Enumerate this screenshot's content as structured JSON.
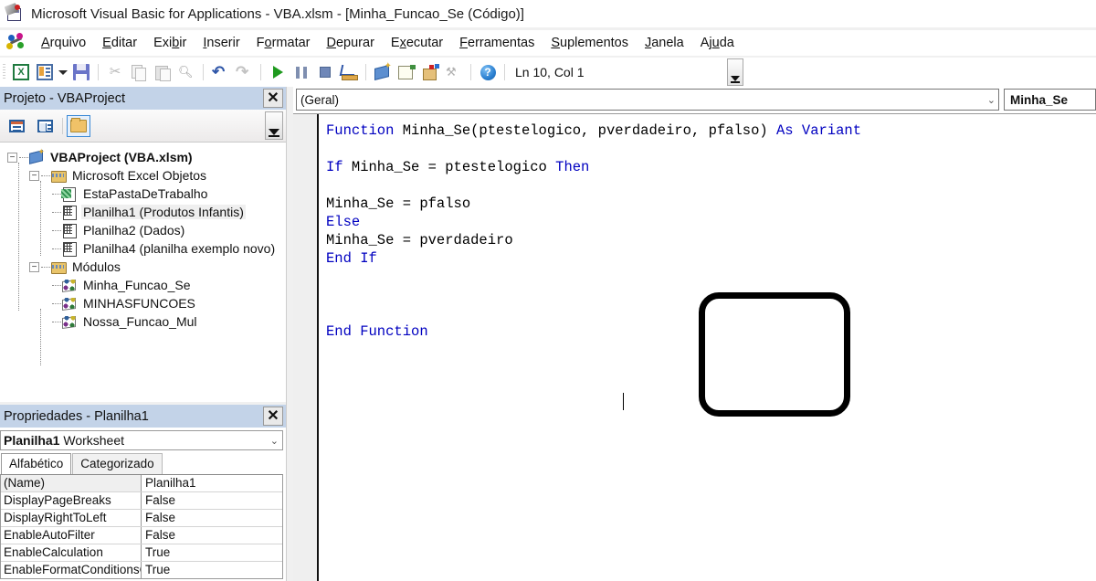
{
  "window": {
    "title": "Microsoft Visual Basic for Applications - VBA.xlsm - [Minha_Funcao_Se (Código)]",
    "app_icon": "vba-app-icon"
  },
  "menubar": {
    "logo_icon": "vba-logo-icon",
    "items": [
      {
        "label": "Arquivo",
        "accel": "A"
      },
      {
        "label": "Editar",
        "accel": "E"
      },
      {
        "label": "Exibir",
        "accel": "b"
      },
      {
        "label": "Inserir",
        "accel": "I"
      },
      {
        "label": "Formatar",
        "accel": "o"
      },
      {
        "label": "Depurar",
        "accel": "D"
      },
      {
        "label": "Executar",
        "accel": "x"
      },
      {
        "label": "Ferramentas",
        "accel": "F"
      },
      {
        "label": "Suplementos",
        "accel": "S"
      },
      {
        "label": "Janela",
        "accel": "J"
      },
      {
        "label": "Ajuda",
        "accel": "u"
      }
    ]
  },
  "toolbar": {
    "buttons": [
      {
        "name": "view-excel-icon",
        "title": "Exibir Microsoft Excel",
        "enabled": true
      },
      {
        "name": "insert-userform-icon",
        "title": "Inserir UserForm",
        "enabled": true
      },
      {
        "name": "insert-dropdown-caret-icon",
        "title": "Inserir",
        "enabled": true
      },
      {
        "name": "save-icon",
        "title": "Salvar VBA.xlsm",
        "enabled": true
      },
      {
        "name": "cut-icon",
        "title": "Recortar",
        "enabled": false
      },
      {
        "name": "copy-icon",
        "title": "Copiar",
        "enabled": false
      },
      {
        "name": "paste-icon",
        "title": "Colar",
        "enabled": false
      },
      {
        "name": "find-icon",
        "title": "Localizar",
        "enabled": true
      },
      {
        "name": "undo-icon",
        "title": "Desfazer",
        "enabled": true
      },
      {
        "name": "redo-icon",
        "title": "Refazer",
        "enabled": false
      },
      {
        "name": "run-icon",
        "title": "Executar Sub/UserForm",
        "enabled": true
      },
      {
        "name": "pause-icon",
        "title": "Interromper",
        "enabled": true
      },
      {
        "name": "stop-icon",
        "title": "Redefinir",
        "enabled": true
      },
      {
        "name": "design-mode-icon",
        "title": "Modo de Design",
        "enabled": true
      },
      {
        "name": "project-explorer-icon",
        "title": "Project Explorer",
        "enabled": true
      },
      {
        "name": "properties-window-icon",
        "title": "Janela Propriedades",
        "enabled": true
      },
      {
        "name": "object-browser-icon",
        "title": "Pesquisador de Objetos",
        "enabled": true
      },
      {
        "name": "toolbox-icon",
        "title": "Caixa de Ferramentas",
        "enabled": false
      },
      {
        "name": "help-icon",
        "title": "Ajuda",
        "enabled": true
      }
    ],
    "position_indicator": "Ln 10, Col 1",
    "spinner_icon": "scroll-down-icon"
  },
  "project_explorer": {
    "title": "Projeto - VBAProject",
    "close_label": "✕",
    "toolbar": [
      {
        "name": "view-code-icon",
        "label": "Exibir Código",
        "active": false
      },
      {
        "name": "view-object-icon",
        "label": "Exibir Objeto",
        "active": false
      },
      {
        "name": "toggle-folders-icon",
        "label": "Alternar Pastas",
        "active": true
      }
    ],
    "scroll_icon": "scroll-down-icon",
    "tree": [
      {
        "label": "VBAProject (VBA.xlsm)",
        "icon": "vba-project-icon",
        "indent": 0,
        "bold": true,
        "expander": "-",
        "selected": false
      },
      {
        "label": "Microsoft Excel Objetos",
        "icon": "folder-icon",
        "indent": 1,
        "bold": false,
        "expander": "-",
        "selected": false
      },
      {
        "label": "EstaPastaDeTrabalho",
        "icon": "workbook-icon",
        "indent": 2,
        "bold": false,
        "expander": "",
        "selected": false
      },
      {
        "label": "Planilha1 (Produtos Infantis)",
        "icon": "worksheet-icon",
        "indent": 2,
        "bold": false,
        "expander": "",
        "selected": true
      },
      {
        "label": "Planilha2 (Dados)",
        "icon": "worksheet-icon",
        "indent": 2,
        "bold": false,
        "expander": "",
        "selected": false
      },
      {
        "label": "Planilha4 (planilha exemplo novo)",
        "icon": "worksheet-icon",
        "indent": 2,
        "bold": false,
        "expander": "",
        "selected": false
      },
      {
        "label": "Módulos",
        "icon": "folder-icon",
        "indent": 1,
        "bold": false,
        "expander": "-",
        "selected": false
      },
      {
        "label": "Minha_Funcao_Se",
        "icon": "module-icon",
        "indent": 2,
        "bold": false,
        "expander": "",
        "selected": false
      },
      {
        "label": "MINHASFUNCOES",
        "icon": "module-icon",
        "indent": 2,
        "bold": false,
        "expander": "",
        "selected": false
      },
      {
        "label": "Nossa_Funcao_Mul",
        "icon": "module-icon",
        "indent": 2,
        "bold": false,
        "expander": "",
        "selected": false
      }
    ]
  },
  "properties": {
    "title": "Propriedades - Planilha1",
    "close_label": "✕",
    "object_name": "Planilha1",
    "object_type": "Worksheet",
    "dropdown_icon": "chevron-down-icon",
    "tabs": [
      {
        "label": "Alfabético",
        "active": true
      },
      {
        "label": "Categorizado",
        "active": false
      }
    ],
    "rows": [
      {
        "key": "(Name)",
        "value": "Planilha1"
      },
      {
        "key": "DisplayPageBreaks",
        "value": "False"
      },
      {
        "key": "DisplayRightToLeft",
        "value": "False"
      },
      {
        "key": "EnableAutoFilter",
        "value": "False"
      },
      {
        "key": "EnableCalculation",
        "value": "True"
      },
      {
        "key": "EnableFormatConditionsCa",
        "value": "True"
      }
    ]
  },
  "code_editor": {
    "scope_dropdown": "(Geral)",
    "scope_dropdown_icon": "chevron-down-icon",
    "procedure_dropdown": "Minha_Se",
    "lines": [
      [
        {
          "t": "Function ",
          "k": true
        },
        {
          "t": "Minha_Se(ptestelogico, pverdadeiro, pfalso) ",
          "k": false
        },
        {
          "t": "As Variant",
          "k": true
        }
      ],
      [],
      [
        {
          "t": "If ",
          "k": true
        },
        {
          "t": "Minha_Se = ptestelogico ",
          "k": false
        },
        {
          "t": "Then",
          "k": true
        }
      ],
      [],
      [
        {
          "t": "Minha_Se = pfalso",
          "k": false
        }
      ],
      [
        {
          "t": "Else",
          "k": true
        }
      ],
      [
        {
          "t": "Minha_Se = pverdadeiro",
          "k": false
        }
      ],
      [
        {
          "t": "End If",
          "k": true
        }
      ],
      [],
      [],
      [],
      [
        {
          "t": "End Function",
          "k": true
        }
      ]
    ],
    "annotation": {
      "name": "highlight-rectangle",
      "shape": "rounded-rect"
    },
    "caret_visible": true
  },
  "colors": {
    "keyword": "#0000C0",
    "identifier": "#000000",
    "panel_titlebar": "#c3d3e8",
    "annotation": "#000000",
    "tree_selection": "#efefef"
  }
}
